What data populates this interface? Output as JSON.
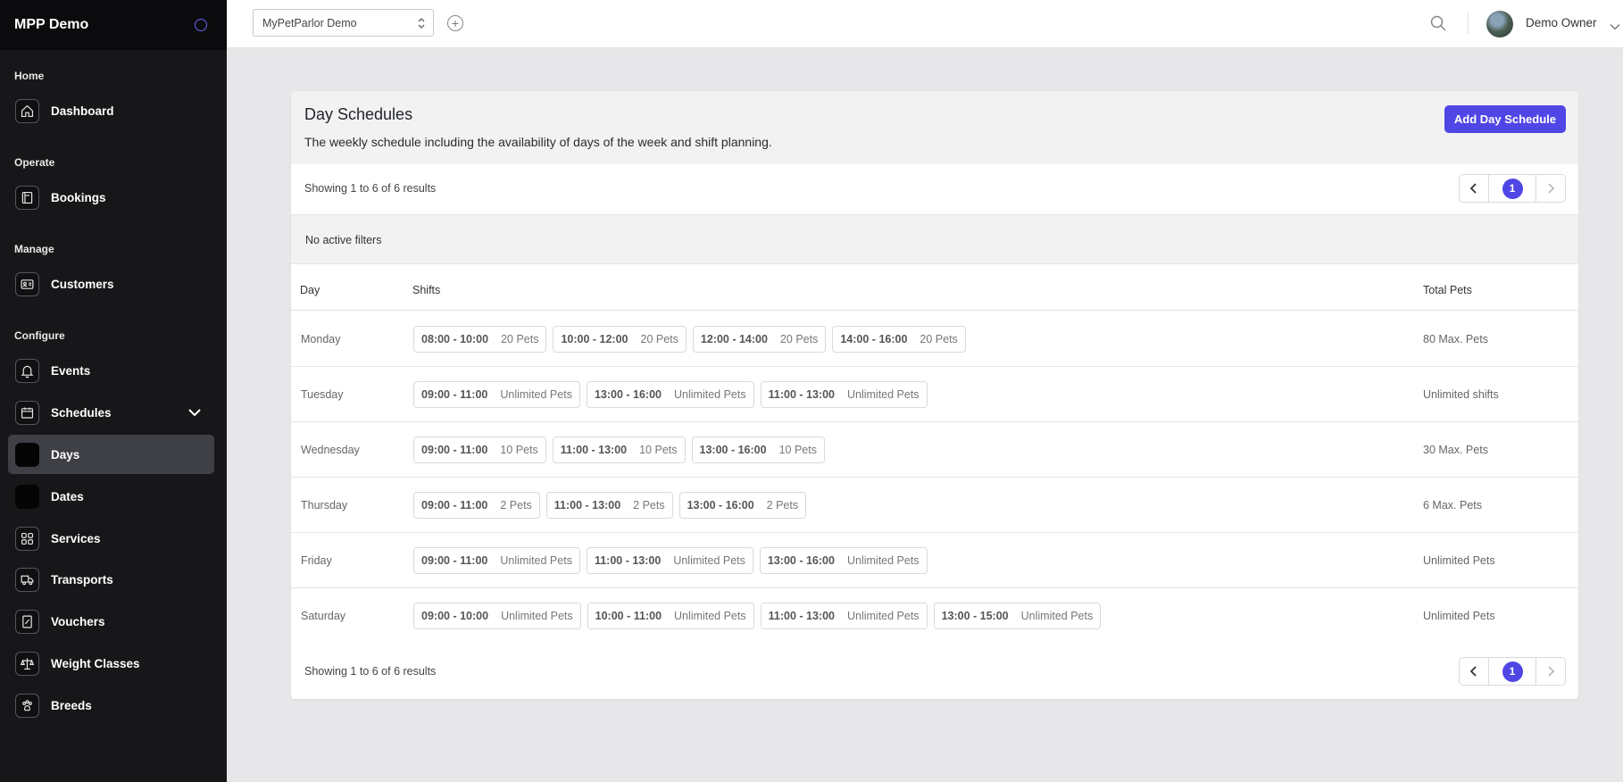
{
  "sidebar": {
    "title": "MPP Demo",
    "sections": {
      "home": "Home",
      "operate": "Operate",
      "manage": "Manage",
      "configure": "Configure"
    },
    "items": {
      "dashboard": "Dashboard",
      "bookings": "Bookings",
      "customers": "Customers",
      "events": "Events",
      "schedules": "Schedules",
      "days": "Days",
      "dates": "Dates",
      "services": "Services",
      "transports": "Transports",
      "vouchers": "Vouchers",
      "weight_classes": "Weight Classes",
      "breeds": "Breeds"
    },
    "active_item": "days"
  },
  "topbar": {
    "tenant": "MyPetParlor Demo",
    "user_name": "Demo Owner"
  },
  "card": {
    "title": "Day Schedules",
    "description": "The weekly schedule including the availability of days of the week and shift planning.",
    "add_button": "Add Day Schedule",
    "results_text": "Showing 1 to 6 of 6 results",
    "current_page": "1",
    "filters_text": "No active filters",
    "columns": {
      "day": "Day",
      "shifts": "Shifts",
      "total": "Total Pets"
    },
    "rows": [
      {
        "day": "Monday",
        "total": "80 Max. Pets",
        "shifts": [
          {
            "time": "08:00 - 10:00",
            "pets": "20 Pets"
          },
          {
            "time": "10:00 - 12:00",
            "pets": "20 Pets"
          },
          {
            "time": "12:00 - 14:00",
            "pets": "20 Pets"
          },
          {
            "time": "14:00 - 16:00",
            "pets": "20 Pets"
          }
        ]
      },
      {
        "day": "Tuesday",
        "total": "Unlimited shifts",
        "shifts": [
          {
            "time": "09:00 - 11:00",
            "pets": "Unlimited Pets"
          },
          {
            "time": "13:00 - 16:00",
            "pets": "Unlimited Pets"
          },
          {
            "time": "11:00 - 13:00",
            "pets": "Unlimited Pets"
          }
        ]
      },
      {
        "day": "Wednesday",
        "total": "30 Max. Pets",
        "shifts": [
          {
            "time": "09:00 - 11:00",
            "pets": "10 Pets"
          },
          {
            "time": "11:00 - 13:00",
            "pets": "10 Pets"
          },
          {
            "time": "13:00 - 16:00",
            "pets": "10 Pets"
          }
        ]
      },
      {
        "day": "Thursday",
        "total": "6 Max. Pets",
        "shifts": [
          {
            "time": "09:00 - 11:00",
            "pets": "2 Pets"
          },
          {
            "time": "11:00 - 13:00",
            "pets": "2 Pets"
          },
          {
            "time": "13:00 - 16:00",
            "pets": "2 Pets"
          }
        ]
      },
      {
        "day": "Friday",
        "total": "Unlimited Pets",
        "shifts": [
          {
            "time": "09:00 - 11:00",
            "pets": "Unlimited Pets"
          },
          {
            "time": "11:00 - 13:00",
            "pets": "Unlimited Pets"
          },
          {
            "time": "13:00 - 16:00",
            "pets": "Unlimited Pets"
          }
        ]
      },
      {
        "day": "Saturday",
        "total": "Unlimited Pets",
        "shifts": [
          {
            "time": "09:00 - 10:00",
            "pets": "Unlimited Pets"
          },
          {
            "time": "10:00 - 11:00",
            "pets": "Unlimited Pets"
          },
          {
            "time": "11:00 - 13:00",
            "pets": "Unlimited Pets"
          },
          {
            "time": "13:00 - 15:00",
            "pets": "Unlimited Pets"
          }
        ]
      }
    ]
  },
  "colors": {
    "accent": "#4f46e5",
    "sidebar_bg": "#17171a",
    "page_bg": "#e7e7e9"
  }
}
